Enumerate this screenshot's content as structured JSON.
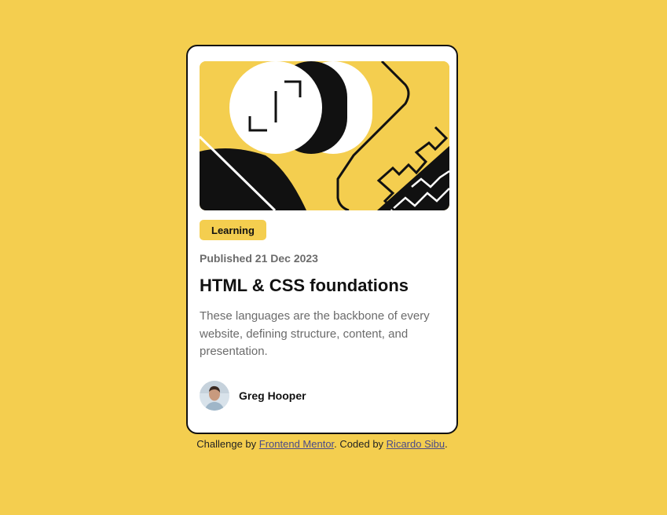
{
  "colors": {
    "background": "#F4CE4F",
    "card": "#FFFFFF",
    "text_dark": "#111111",
    "text_grey": "#6B6B6B",
    "link": "#4A4A8A"
  },
  "card": {
    "illustration": "abstract-illustration",
    "tag": "Learning",
    "published": "Published 21 Dec 2023",
    "title": "HTML & CSS foundations",
    "description": "These languages are the backbone of every website, defining structure, content, and presentation.",
    "author": {
      "avatar": "avatar-image",
      "name": "Greg Hooper"
    }
  },
  "footer": {
    "prefix": "Challenge by",
    "link1": "Frontend Mentor",
    "middle": ". Coded by",
    "link2": "Ricardo Sibu",
    "suffix": "."
  }
}
